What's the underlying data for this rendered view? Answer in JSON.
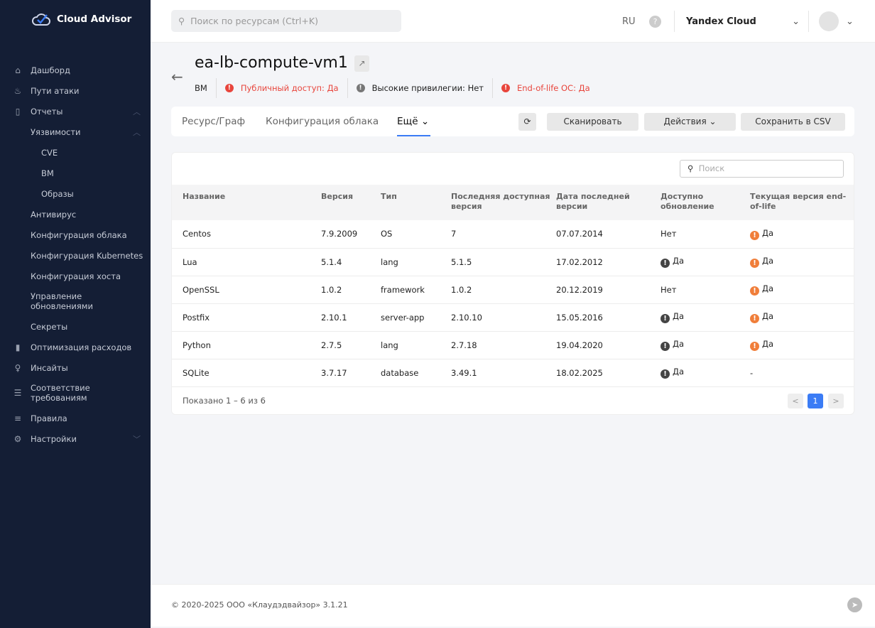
{
  "app": {
    "name": "Cloud Advisor"
  },
  "sidebar": {
    "items": [
      {
        "label": "Дашборд",
        "icon": "home-icon"
      },
      {
        "label": "Пути атаки",
        "icon": "fire-icon"
      },
      {
        "label": "Отчеты",
        "icon": "document-icon"
      },
      {
        "label": "Уязвимости"
      },
      {
        "label": "CVE"
      },
      {
        "label": "ВМ"
      },
      {
        "label": "Образы"
      },
      {
        "label": "Антивирус"
      },
      {
        "label": "Конфигурация облака"
      },
      {
        "label": "Конфигурация Kubernetes"
      },
      {
        "label": "Конфигурация хоста"
      },
      {
        "label": "Управление обновлениями"
      },
      {
        "label": "Секреты"
      },
      {
        "label": "Оптимизация расходов",
        "icon": "chart-icon"
      },
      {
        "label": "Инсайты",
        "icon": "bulb-icon"
      },
      {
        "label": "Соответствие требованиям",
        "icon": "list-icon"
      },
      {
        "label": "Правила",
        "icon": "rules-icon"
      },
      {
        "label": "Настройки",
        "icon": "gear-icon"
      }
    ]
  },
  "header": {
    "search_placeholder": "Поиск по ресурсам (Ctrl+K)",
    "lang": "RU",
    "cloud": "Yandex Cloud"
  },
  "resource": {
    "title": "ea-lb-compute-vm1",
    "type": "ВМ",
    "public": "Публичный доступ: Да",
    "privileges": "Высокие привилегии: Нет",
    "eol": "End-of-life ОС: Да"
  },
  "tabs": {
    "resource": "Ресурс/Граф",
    "config": "Конфигурация облака",
    "more": "Ещё",
    "scan": "Сканировать",
    "actions": "Действия",
    "csv": "Сохранить в CSV"
  },
  "table": {
    "search_placeholder": "Поиск",
    "headers": [
      "Название",
      "Версия",
      "Тип",
      "Последняя доступная версия",
      "Дата последней версии",
      "Доступно обновление",
      "Текущая версия end-of-life"
    ],
    "rows": [
      [
        "Centos",
        "7.9.2009",
        "OS",
        "7",
        "07.07.2014",
        "Нет",
        "Да"
      ],
      [
        "Lua",
        "5.1.4",
        "lang",
        "5.1.5",
        "17.02.2012",
        "Да",
        "Да"
      ],
      [
        "OpenSSL",
        "1.0.2",
        "framework",
        "1.0.2",
        "20.12.2019",
        "Нет",
        "Да"
      ],
      [
        "Postfix",
        "2.10.1",
        "server-app",
        "2.10.10",
        "15.05.2016",
        "Да",
        "Да"
      ],
      [
        "Python",
        "2.7.5",
        "lang",
        "2.7.18",
        "19.04.2020",
        "Да",
        "Да"
      ],
      [
        "SQLite",
        "3.7.17",
        "database",
        "3.49.1",
        "18.02.2025",
        "Да",
        "-"
      ]
    ],
    "shown": "Показано 1 – 6 из 6",
    "page": "1",
    "prev": "<",
    "next": ">"
  },
  "footer": {
    "copyright": "© 2020-2025 ООО «Клаудэдвайзор» 3.1.21"
  }
}
